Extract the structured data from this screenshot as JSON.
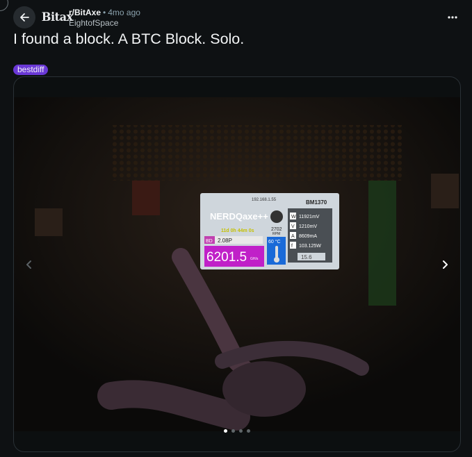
{
  "post": {
    "subreddit": "r/BitAxe",
    "avatar_text": "Bitax",
    "separator": "•",
    "time_ago": "4mo ago",
    "author": "EightofSpace",
    "title": "I found a block. A BTC Block. Solo.",
    "flair": "bestdiff"
  },
  "gallery": {
    "image_count": 4,
    "active_index": 0
  },
  "device_screen": {
    "ip": "192.168.1.55",
    "chip": "BM1370",
    "brand": "NERDQaxe++",
    "uptime": "11d 0h 44m 0s",
    "bd_label": "BD",
    "best_diff": "2.08P",
    "hashrate": "6201.5",
    "hashrate_unit": "GH/s",
    "fan_rpm": "2702",
    "fan_unit": "RPM",
    "temp": "60 °C",
    "stats": [
      {
        "tag": "W",
        "value": "11921mV"
      },
      {
        "tag": "V",
        "value": "1210mV"
      },
      {
        "tag": "A",
        "value": "8609mA"
      },
      {
        "tag": "f",
        "value": "103.125W"
      }
    ],
    "percent": "15.6"
  },
  "colors": {
    "background": "#0e1113",
    "flair_bg": "#6a38d6",
    "meta_text": "#8ba2ad"
  },
  "icons": [
    "back-arrow-icon",
    "more-options-icon",
    "chevron-left-icon",
    "chevron-right-icon"
  ]
}
